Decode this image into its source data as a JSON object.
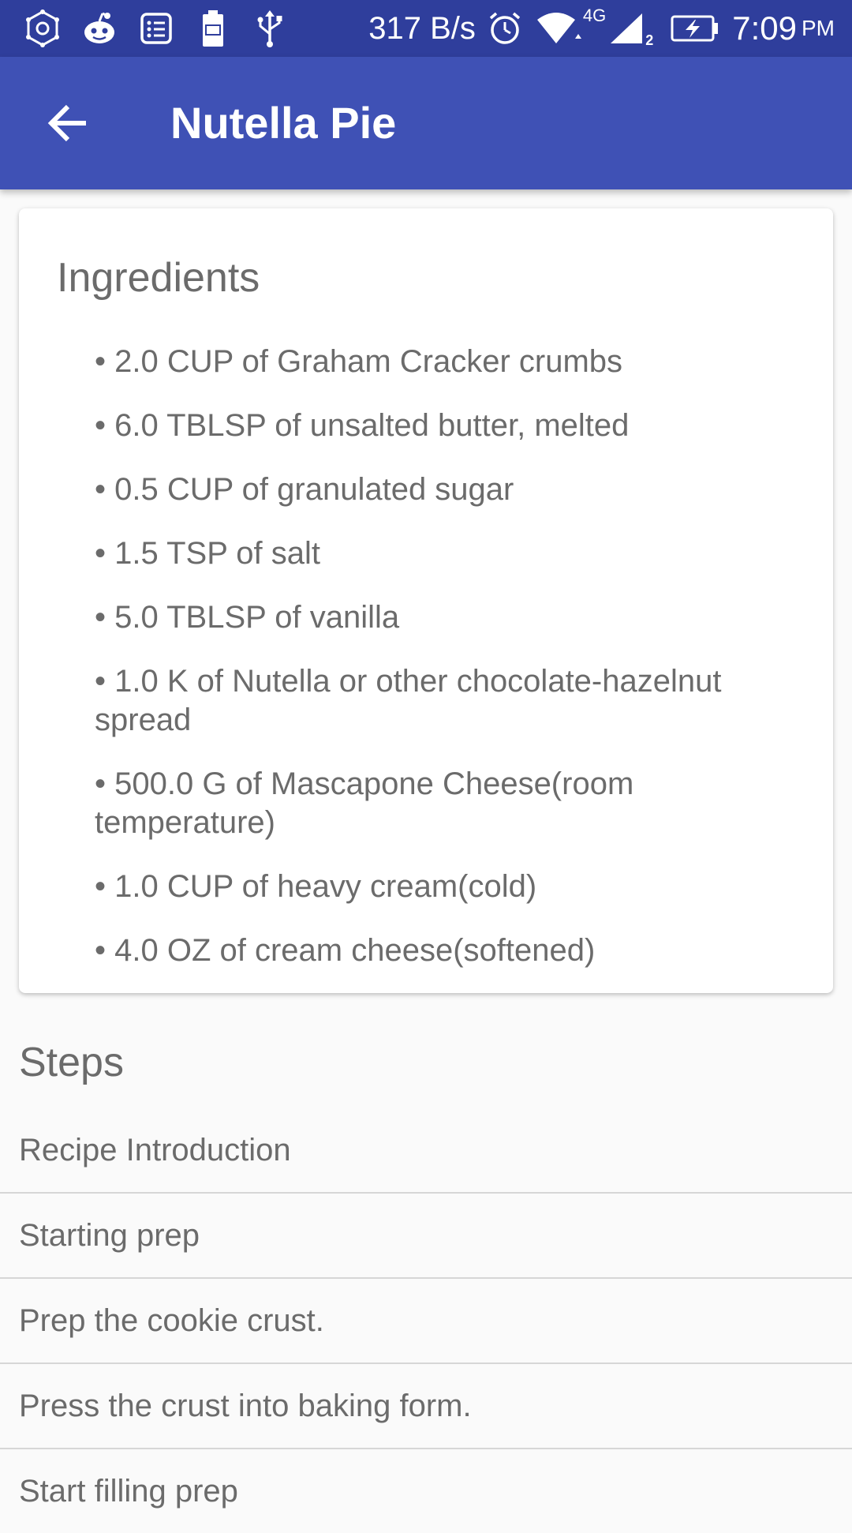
{
  "status_bar": {
    "left_icons": [
      "hexagon-settings-icon",
      "reddit-icon",
      "list-app-icon",
      "battery-100-icon",
      "usb-icon"
    ],
    "network_speed": "317 B/s",
    "network_type": "4G",
    "sim_slot": "2",
    "time": "7:09",
    "ampm": "PM",
    "right_icons": [
      "alarm-icon",
      "wifi-icon",
      "cell-signal-icon",
      "battery-charging-icon"
    ]
  },
  "app_bar": {
    "title": "Nutella Pie",
    "back_icon": "arrow-back-icon",
    "color": "#3f51b5"
  },
  "ingredients": {
    "heading": "Ingredients",
    "items": [
      "• 2.0 CUP of Graham Cracker crumbs",
      "• 6.0 TBLSP of unsalted butter, melted",
      "• 0.5 CUP of granulated sugar",
      "• 1.5 TSP of salt",
      "• 5.0 TBLSP of vanilla",
      "• 1.0 K of Nutella or other chocolate-hazelnut spread",
      "• 500.0 G of Mascapone Cheese(room temperature)",
      "• 1.0 CUP of heavy cream(cold)",
      "• 4.0 OZ of cream cheese(softened)"
    ]
  },
  "steps": {
    "heading": "Steps",
    "items": [
      "Recipe Introduction",
      "Starting prep",
      "Prep the cookie crust.",
      "Press the crust into baking form.",
      "Start filling prep"
    ]
  }
}
